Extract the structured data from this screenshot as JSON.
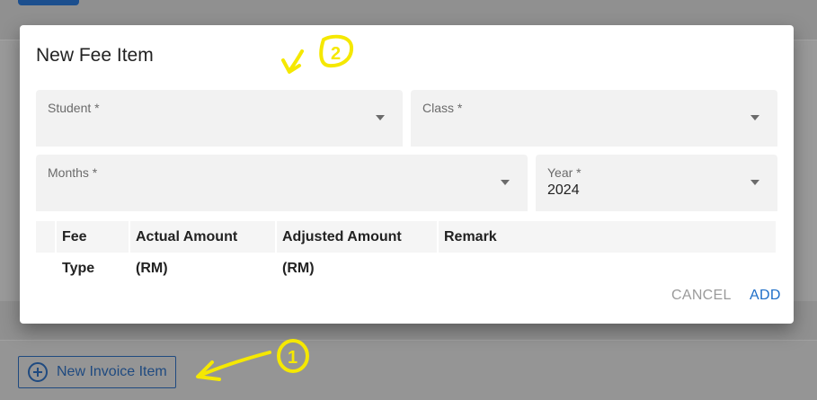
{
  "background": {
    "new_invoice_label": "New Invoice Item"
  },
  "dialog": {
    "title": "New Fee Item",
    "fields": {
      "student": {
        "label": "Student *",
        "value": ""
      },
      "class": {
        "label": "Class *",
        "value": ""
      },
      "months": {
        "label": "Months *",
        "value": ""
      },
      "year": {
        "label": "Year *",
        "value": "2024"
      }
    },
    "table": {
      "columns": [
        "Fee Type",
        "Actual Amount (RM)",
        "Adjusted Amount (RM)",
        "Remark"
      ]
    },
    "actions": {
      "cancel": "CANCEL",
      "add": "ADD"
    }
  },
  "annotations": {
    "marker_1": "1",
    "marker_2": "2",
    "color": "#f5e800"
  },
  "colors": {
    "accent": "#1e6ec8",
    "outline_button": "#1f4a80"
  }
}
